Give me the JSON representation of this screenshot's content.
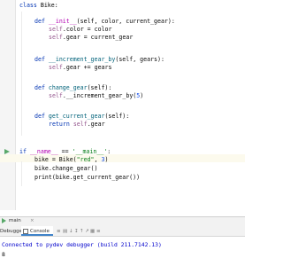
{
  "editor": {
    "lines": {
      "l1": {
        "kw": "class",
        "name": "Bike",
        "tail": ":"
      },
      "l2": {
        "kw": "def",
        "name": "__init__",
        "tail": "(self, color, current_gear):"
      },
      "l3": {
        "self": "self",
        "tail": ".color = color"
      },
      "l4": {
        "self": "self",
        "tail": ".gear = current_gear"
      },
      "l5": {
        "kw": "def",
        "name": "__increment_gear_by",
        "tail": "(self, gears):"
      },
      "l6": {
        "self": "self",
        "tail": ".gear += gears"
      },
      "l7": {
        "kw": "def",
        "name": "change_gear",
        "tail": "(self):"
      },
      "l8": {
        "self": "self",
        "tail": ".__increment_gear_by(",
        "num": "5",
        "end": ")"
      },
      "l9": {
        "kw": "def",
        "name": "get_current_gear",
        "tail": "(self):"
      },
      "l10": {
        "kw": "return",
        "self": "self",
        "tail": ".gear"
      },
      "l11": {
        "kw": "if",
        "dunder": "__name__",
        "mid": " == ",
        "str": "'__main__'",
        "end": ":"
      },
      "l12": {
        "head": "bike = Bike(",
        "str": "\"red\"",
        "mid": ", ",
        "num": "3",
        "end": ")"
      },
      "l13": {
        "text": "bike.change_gear()"
      },
      "l14": {
        "text": "print(bike.get_current_gear())"
      }
    }
  },
  "run_panel": {
    "tab_label": "main",
    "debugger_tab": "Debugger",
    "console_tab": "Console",
    "output_line1": "Connected to pydev debugger (build 211.7142.13)",
    "output_line2": "8"
  },
  "colors": {
    "keyword": "#0033b3",
    "function_name": "#00627a",
    "self": "#94558d",
    "number": "#1750eb",
    "string": "#067d17",
    "dunder": "#b200b2"
  }
}
